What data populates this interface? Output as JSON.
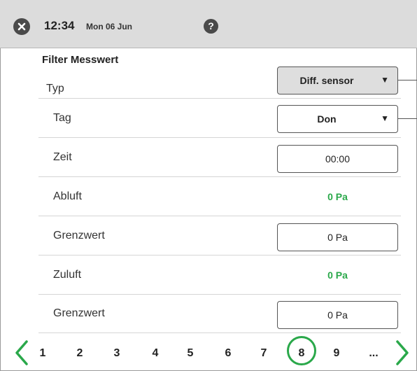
{
  "header": {
    "time": "12:34",
    "date": "Mon 06 Jun",
    "close_icon": "close-icon",
    "help_label": "?"
  },
  "section_title": "Filter Messwert",
  "rows": [
    {
      "label": "Typ",
      "kind": "select",
      "value": "Diff. sensor",
      "arrow": "▼"
    },
    {
      "label": "Tag",
      "kind": "select",
      "value": "Don",
      "arrow": "▼"
    },
    {
      "label": "Zeit",
      "kind": "input",
      "value": "00:00"
    },
    {
      "label": "Abluft",
      "kind": "readout",
      "value": "0 Pa"
    },
    {
      "label": "Grenzwert",
      "kind": "input",
      "value": "0 Pa"
    },
    {
      "label": "Zuluft",
      "kind": "readout",
      "value": "0 Pa"
    },
    {
      "label": "Grenzwert",
      "kind": "input",
      "value": "0 Pa"
    }
  ],
  "pager": {
    "pages": [
      "1",
      "2",
      "3",
      "4",
      "5",
      "6",
      "7",
      "8",
      "9",
      "..."
    ],
    "active": "8"
  },
  "colors": {
    "accent_green": "#2aa84a",
    "header_bg": "#dcdcdc",
    "select_grey": "#dedede"
  }
}
